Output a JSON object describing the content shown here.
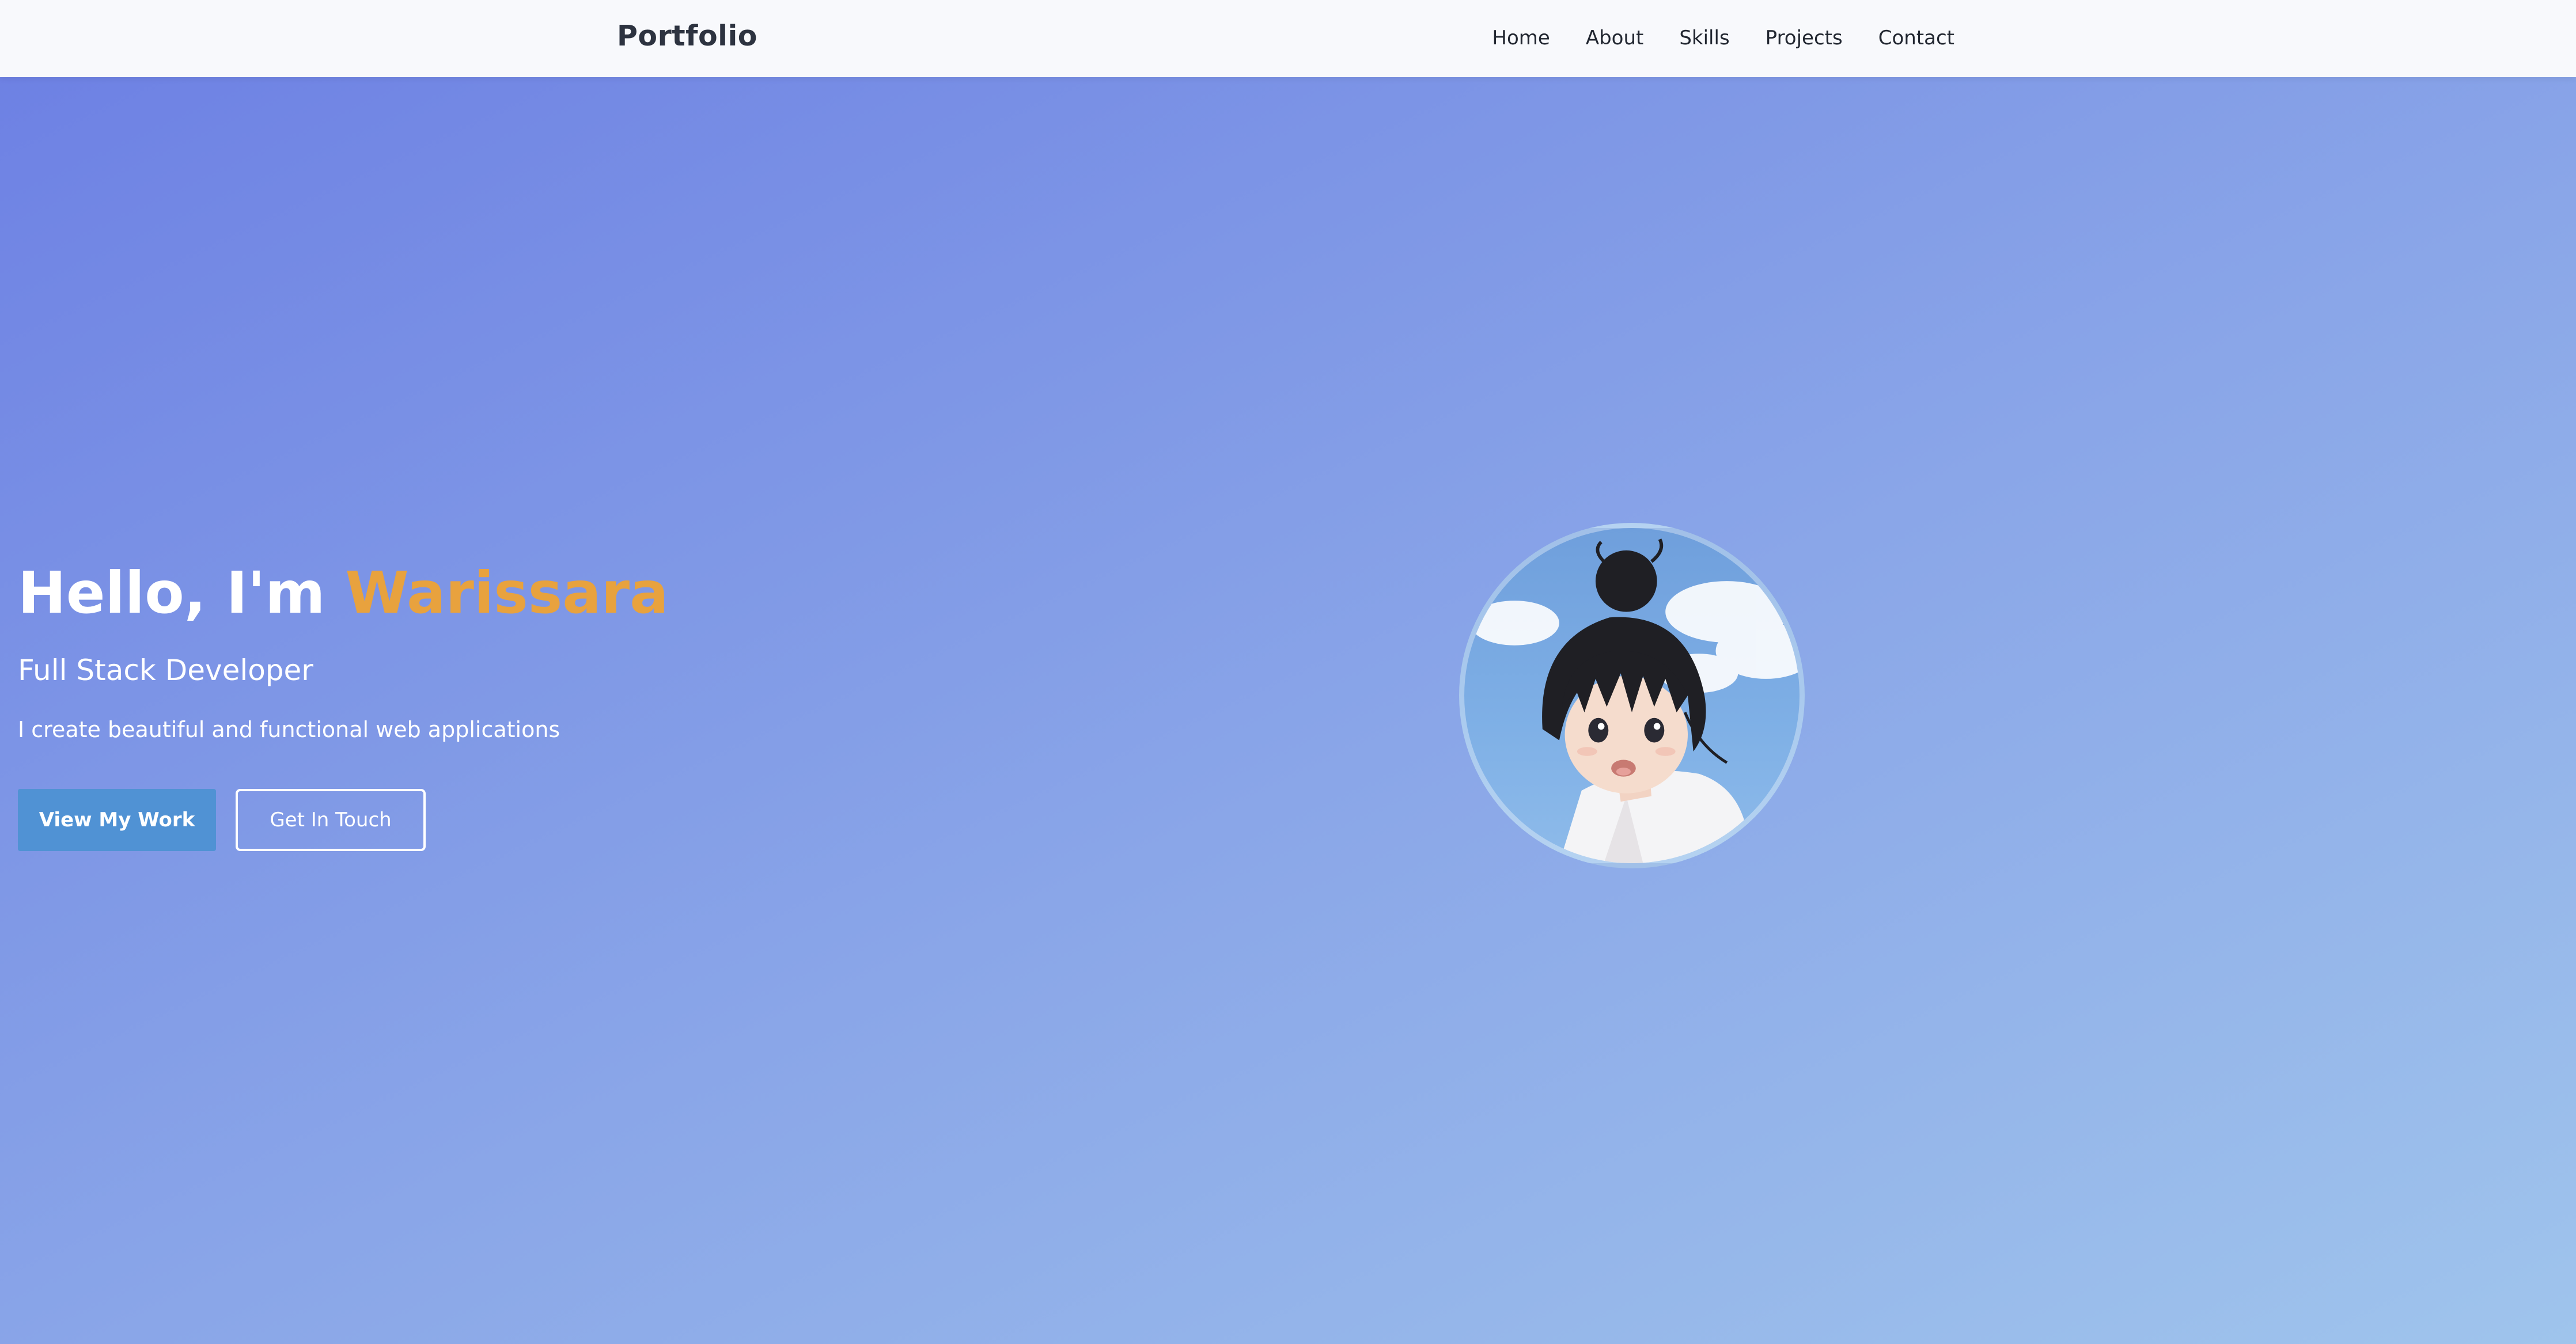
{
  "nav": {
    "brand": "Portfolio",
    "links": [
      "Home",
      "About",
      "Skills",
      "Projects",
      "Contact"
    ]
  },
  "hero": {
    "greeting": "Hello, I'm ",
    "name": "Warissara",
    "subtitle": "Full Stack Developer",
    "description": "I create beautiful and functional web applications",
    "primary_button": "View My Work",
    "secondary_button": "Get In Touch"
  },
  "colors": {
    "accent_name": "#e8a23e",
    "primary_button": "#5092d4",
    "gradient_start": "#6c7fe3",
    "gradient_end": "#9fc4ec"
  },
  "avatar": {
    "icon": "anime-girl-portrait"
  }
}
